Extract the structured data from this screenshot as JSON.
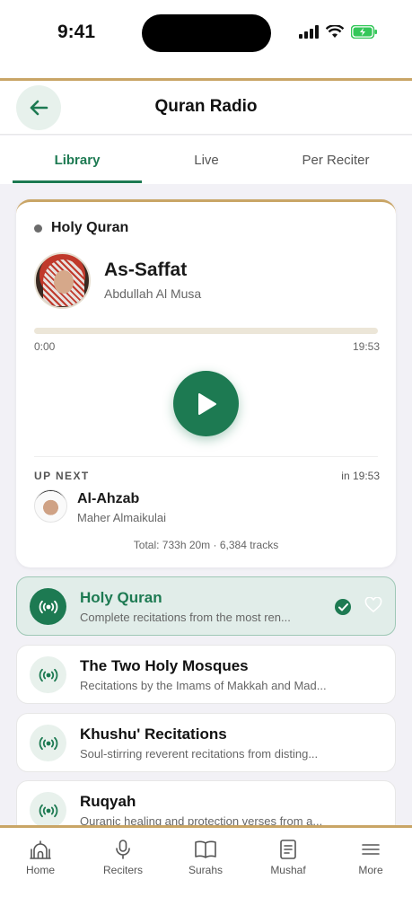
{
  "status_bar": {
    "time": "9:41"
  },
  "header": {
    "title": "Quran Radio"
  },
  "tabs": [
    {
      "label": "Library",
      "active": true
    },
    {
      "label": "Live",
      "active": false
    },
    {
      "label": "Per Reciter",
      "active": false
    }
  ],
  "player": {
    "station": "Holy Quran",
    "track": "As-Saffat",
    "reciter": "Abdullah Al Musa",
    "elapsed": "0:00",
    "duration": "19:53",
    "progress_fraction": 0.0,
    "up_next_label": "UP NEXT",
    "up_next_in": "in 19:53",
    "next_track": "Al-Ahzab",
    "next_reciter": "Maher Almaikulai",
    "total": "Total: 733h 20m · 6,384 tracks"
  },
  "channels": [
    {
      "title": "Holy Quran",
      "desc": "Complete recitations from the most ren...",
      "selected": true
    },
    {
      "title": "The Two Holy Mosques",
      "desc": "Recitations by the Imams of Makkah and Mad...",
      "selected": false
    },
    {
      "title": "Khushu' Recitations",
      "desc": "Soul-stirring reverent recitations from disting...",
      "selected": false
    },
    {
      "title": "Ruqyah",
      "desc": "Quranic healing and protection verses from a...",
      "selected": false
    }
  ],
  "nav": [
    {
      "label": "Home",
      "icon": "mosque-icon"
    },
    {
      "label": "Reciters",
      "icon": "microphone-icon"
    },
    {
      "label": "Surahs",
      "icon": "open-book-icon"
    },
    {
      "label": "Mushaf",
      "icon": "quran-book-icon"
    },
    {
      "label": "More",
      "icon": "menu-icon"
    }
  ],
  "colors": {
    "accent": "#1d7a52",
    "gold": "#c9a566",
    "selected_bg": "#e1ede9"
  }
}
